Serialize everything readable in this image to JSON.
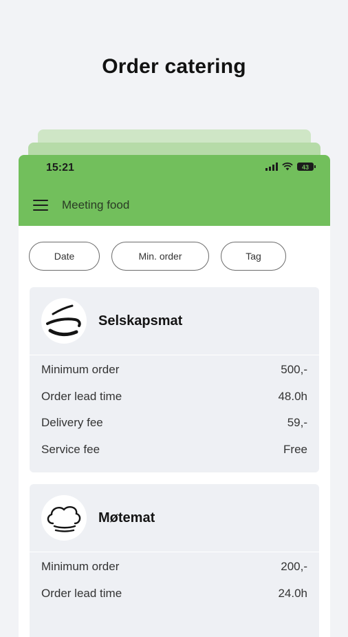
{
  "hero": {
    "title": "Order catering"
  },
  "status_bar": {
    "time": "15:21",
    "battery": "43"
  },
  "app_bar": {
    "title": "Meeting food"
  },
  "filters": [
    {
      "label": "Date"
    },
    {
      "label": "Min. order"
    },
    {
      "label": "Tag"
    }
  ],
  "vendors": [
    {
      "name": "Selskapsmat",
      "rows": [
        {
          "label": "Minimum order",
          "value": "500,-"
        },
        {
          "label": "Order lead time",
          "value": "48.0h"
        },
        {
          "label": "Delivery fee",
          "value": "59,-"
        },
        {
          "label": "Service fee",
          "value": "Free"
        }
      ]
    },
    {
      "name": "Møtemat",
      "rows": [
        {
          "label": "Minimum order",
          "value": "200,-"
        },
        {
          "label": "Order lead time",
          "value": "24.0h"
        }
      ]
    }
  ],
  "colors": {
    "accent": "#72bf5c",
    "background": "#f2f3f6",
    "card": "#eef0f4"
  }
}
